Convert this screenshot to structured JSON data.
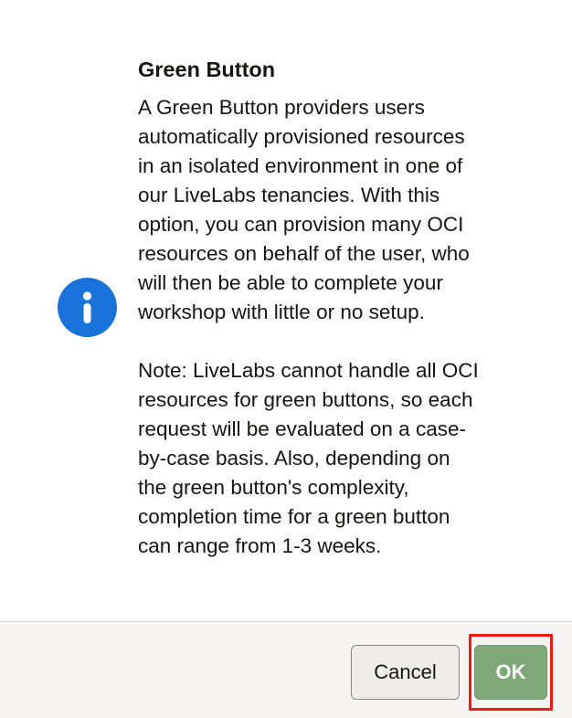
{
  "dialog": {
    "title": "Green Button",
    "icon": "info-icon",
    "paragraphs": [
      "A Green Button providers users\nautomatically provisioned resources\nin an isolated environment in one of\nour LiveLabs tenancies. With this\noption, you can provision many OCI\nresources on behalf of the user, who\nwill then be able to complete your\nworkshop with little or no setup.",
      "Note: LiveLabs cannot handle all OCI\nresources for green buttons, so each\nrequest will be evaluated on a case-\nby-case basis. Also, depending on\nthe green button's complexity,\ncompletion time for a green button\ncan range from 1-3 weeks."
    ]
  },
  "footer": {
    "cancel_label": "Cancel",
    "ok_label": "OK"
  },
  "colors": {
    "info_icon": "#1a73db",
    "ok_button": "#7ea877",
    "highlight": "#ee1c12",
    "footer_bg": "#f7f5f3"
  }
}
